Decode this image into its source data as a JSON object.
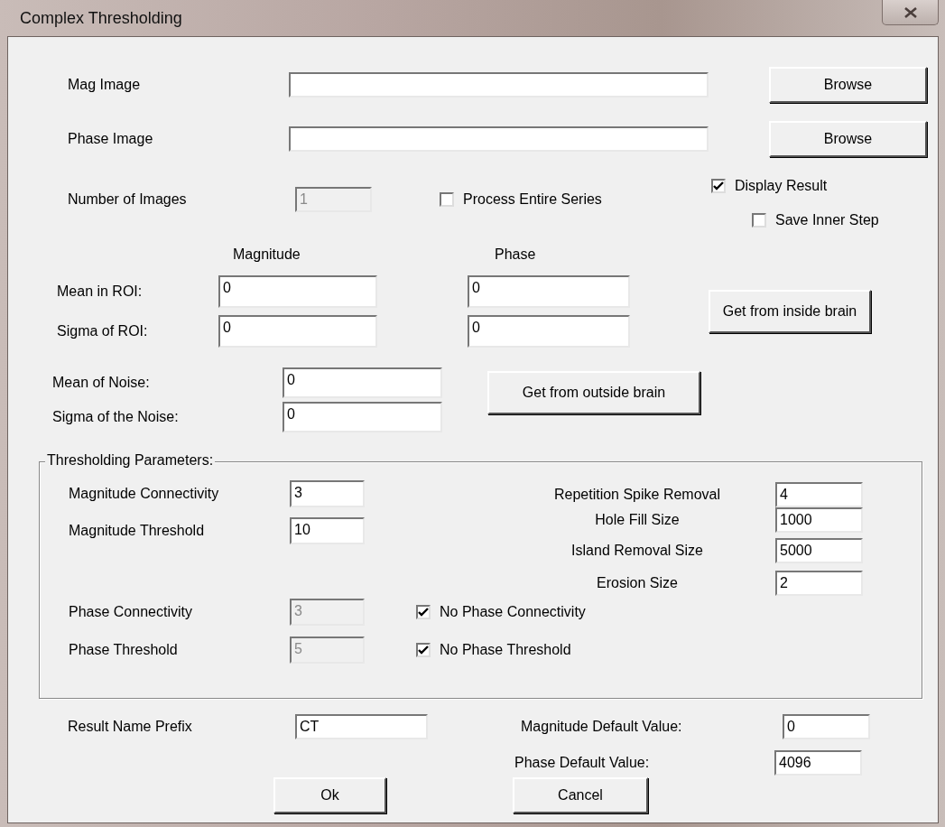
{
  "window": {
    "title": "Complex Thresholding"
  },
  "files": [
    {
      "label": "Mag Image",
      "button": "Browse"
    },
    {
      "label": "Phase Image",
      "button": "Browse"
    }
  ],
  "number_of_images": {
    "label": "Number of Images",
    "value": "1",
    "disabled": true
  },
  "options": [
    {
      "label": "Process Entire Series",
      "checked": false
    },
    {
      "label": "Display Result",
      "checked": true
    },
    {
      "label": "Save Inner Step",
      "checked": false
    }
  ],
  "roi": {
    "columns": [
      "Magnitude",
      "Phase"
    ],
    "rows": [
      {
        "label": "Mean in ROI:",
        "values": [
          "0",
          "0"
        ]
      },
      {
        "label": "Sigma of ROI:",
        "values": [
          "0",
          "0"
        ]
      }
    ],
    "button": "Get from inside brain"
  },
  "noise": {
    "rows": [
      {
        "label": "Mean of Noise:",
        "value": "0"
      },
      {
        "label": "Sigma of the Noise:",
        "value": "0"
      }
    ],
    "button": "Get from outside brain"
  },
  "thresholding": {
    "legend": "Thresholding Parameters:",
    "magnitude": [
      {
        "label": "Magnitude Connectivity",
        "value": "3",
        "disabled": false
      },
      {
        "label": "Magnitude Threshold",
        "value": "10",
        "disabled": false
      }
    ],
    "cleanup": [
      {
        "label": "Repetition Spike Removal",
        "value": "4"
      },
      {
        "label": "Hole Fill Size",
        "value": "1000"
      },
      {
        "label": "Island Removal Size",
        "value": "5000"
      },
      {
        "label": "Erosion Size",
        "value": "2"
      }
    ],
    "phase": [
      {
        "label": "Phase Connectivity",
        "value": "3",
        "disabled": true,
        "checkbox": {
          "label": "No Phase Connectivity",
          "checked": true
        }
      },
      {
        "label": "Phase Threshold",
        "value": "5",
        "disabled": true,
        "checkbox": {
          "label": "No Phase Threshold",
          "checked": true
        }
      }
    ]
  },
  "result_prefix": {
    "label": "Result Name Prefix",
    "value": "CT"
  },
  "defaults": [
    {
      "label": "Magnitude Default Value:",
      "value": "0"
    },
    {
      "label": "Phase Default Value:",
      "value": "4096"
    }
  ],
  "buttons": [
    "Ok",
    "Cancel"
  ]
}
